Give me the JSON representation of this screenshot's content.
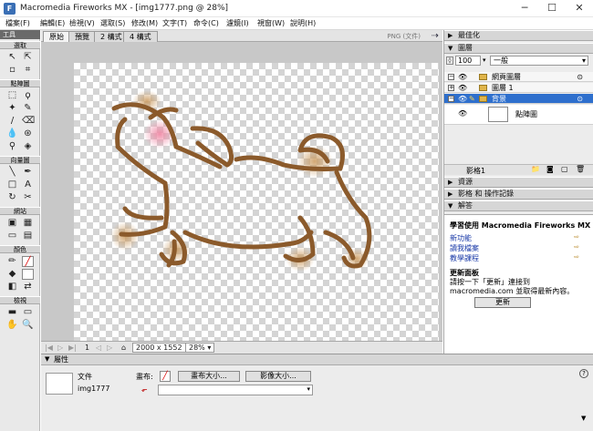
{
  "window": {
    "title": "Macromedia Fireworks MX - [img1777.png @ 28%]",
    "min_label": "─",
    "max_label": "☐",
    "close_label": "✕"
  },
  "menu": [
    "檔案(F)",
    "編輯(E)",
    "檢視(V)",
    "選取(S)",
    "修改(M)",
    "文字(T)",
    "命令(C)",
    "濾鏡(I)",
    "視窗(W)",
    "說明(H)"
  ],
  "tools": {
    "panel_title": "工具",
    "sections": [
      "選取",
      "點陣圖",
      "向量圖",
      "網站",
      "顏色",
      "檢視"
    ]
  },
  "doc_tabs": [
    "原始",
    "預覽",
    "2 構式",
    "4 構式"
  ],
  "doc": {
    "format_label": "PNG (文件)"
  },
  "status": {
    "page": "1",
    "size": "2000 x 1552",
    "zoom": "28%"
  },
  "right": {
    "optimize": "最佳化",
    "layers": "圖層",
    "opacity": "100",
    "blend": "一般",
    "layer_rows": [
      {
        "name": "網頁圖層"
      },
      {
        "name": "圖層 1"
      },
      {
        "name": "背景"
      },
      {
        "name": "點陣圖"
      }
    ],
    "layers_footer": "影格1",
    "assets": "資源",
    "frames": "影格 和 操作記錄",
    "answers": "解答",
    "help_title": "學習使用 Macromedia Fireworks MX",
    "help_links": [
      "新功能",
      "讀我檔案",
      "教學課程"
    ],
    "update_title": "更新面板",
    "update_text1": "請按一下「更新」連接到",
    "update_text2": "macromedia.com 並取得最新內容。",
    "update_button": "更新"
  },
  "props": {
    "title": "屬性",
    "doc_label": "文件",
    "doc_name": "img1777",
    "canvas_label": "畫布:",
    "canvas_size_btn": "畫布大小...",
    "image_size_btn": "影像大小...",
    "help_icon": "?"
  },
  "colors": {
    "selected_row": "#2e6fcd",
    "dog_outline": "#8b5a2b",
    "blush": "#f08aa6"
  }
}
